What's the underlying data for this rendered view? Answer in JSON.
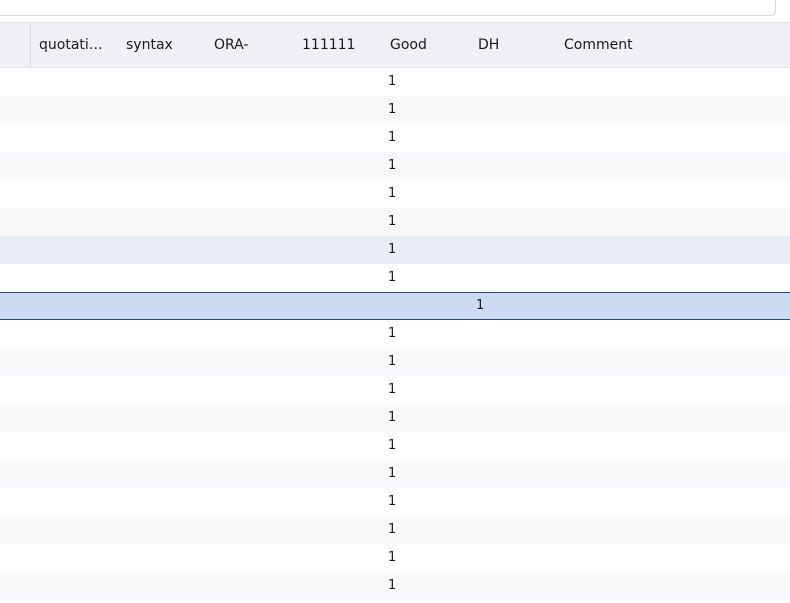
{
  "columns": [
    {
      "label": "",
      "name": "col-blank"
    },
    {
      "label": "quotati…",
      "name": "col-quotation"
    },
    {
      "label": "syntax",
      "name": "col-syntax"
    },
    {
      "label": "ORA-",
      "name": "col-ora"
    },
    {
      "label": "111111",
      "name": "col-111111"
    },
    {
      "label": "Good",
      "name": "col-good"
    },
    {
      "label": "DH",
      "name": "col-dh"
    },
    {
      "label": "Comment",
      "name": "col-comment"
    }
  ],
  "rows": [
    {
      "good": "1",
      "state": "odd"
    },
    {
      "good": "1",
      "state": "even"
    },
    {
      "good": "1",
      "state": "odd"
    },
    {
      "good": "1",
      "state": "even"
    },
    {
      "good": "1",
      "state": "odd"
    },
    {
      "good": "1",
      "state": "even"
    },
    {
      "good": "1",
      "state": "hover"
    },
    {
      "good": "1",
      "state": "odd"
    },
    {
      "good": "1",
      "state": "selected"
    },
    {
      "good": "1",
      "state": "odd"
    },
    {
      "good": "1",
      "state": "even"
    },
    {
      "good": "1",
      "state": "odd"
    },
    {
      "good": "1",
      "state": "even"
    },
    {
      "good": "1",
      "state": "odd"
    },
    {
      "good": "1",
      "state": "even"
    },
    {
      "good": "1",
      "state": "odd"
    },
    {
      "good": "1",
      "state": "even"
    },
    {
      "good": "1",
      "state": "odd"
    },
    {
      "good": "1",
      "state": "even"
    }
  ]
}
